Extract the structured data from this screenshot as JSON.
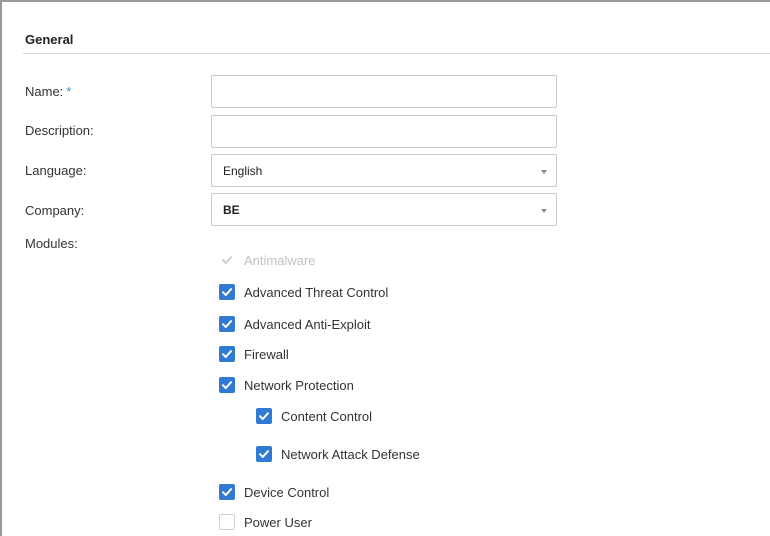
{
  "section": {
    "title": "General"
  },
  "form": {
    "name_label": "Name:",
    "required_marker": "*",
    "name_value": "",
    "description_label": "Description:",
    "description_value": "",
    "language_label": "Language:",
    "language_value": "English",
    "company_label": "Company:",
    "company_value": "BE",
    "modules_label": "Modules:"
  },
  "modules": [
    {
      "label": "Antimalware",
      "checked": true,
      "disabled": true
    },
    {
      "label": "Advanced Threat Control",
      "checked": true,
      "disabled": false
    },
    {
      "label": "Advanced Anti-Exploit",
      "checked": true,
      "disabled": false
    },
    {
      "label": "Firewall",
      "checked": true,
      "disabled": false
    },
    {
      "label": "Network Protection",
      "checked": true,
      "disabled": false
    },
    {
      "label": "Content Control",
      "checked": true,
      "disabled": false
    },
    {
      "label": "Network Attack Defense",
      "checked": true,
      "disabled": false
    },
    {
      "label": "Device Control",
      "checked": true,
      "disabled": false
    },
    {
      "label": "Power User",
      "checked": false,
      "disabled": false
    }
  ],
  "colors": {
    "accent": "#2f7bd3",
    "required": "#3a8fd9",
    "disabled_text": "#c2c2c2"
  }
}
